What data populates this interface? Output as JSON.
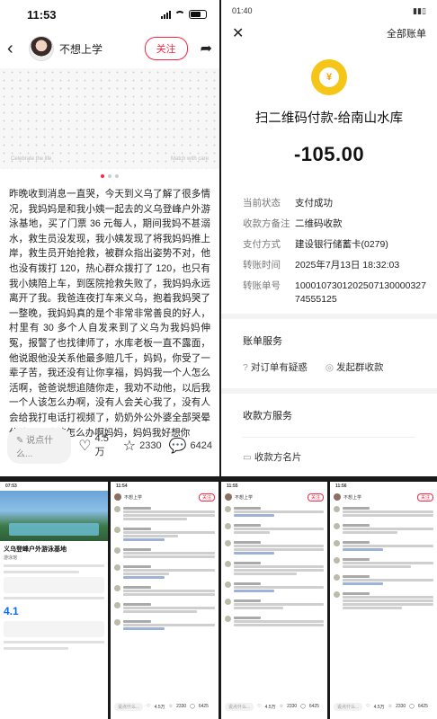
{
  "left_phone": {
    "status_time": "11:53",
    "username": "不想上学",
    "follow_label": "关注",
    "photo_caption_left": "Celebrate the life",
    "photo_caption_right": "Match with care",
    "post_text": "昨晚收到消息一直哭，今天到义乌了解了很多情况，我妈妈是和我小姨一起去的义乌登峰户外游泳基地，买了门票 36 元每人，期间我妈不甚溺水，救生员没发现，我小姨发现了将我妈妈推上岸，救生员开始抢救，被群众指出姿势不对，他也没有拨打 120，热心群众拨打了 120，也只有我小姨陪上车，到医院抢救失败了，我妈妈永远离开了我。我爸连夜打车来义乌，抱着我妈哭了一整晚，我妈妈真的是个非常非常善良的好人，村里有 30 多个人自发来到了义乌为我妈妈伸冤，报警了也找律师了，水库老板一直不露面，他说跟他没关系他最多赔几千，妈妈，你受了一辈子苦，我还没有让你享福，妈妈我一个人怎么活啊，爸爸说想追随你走，我劝不动他，以后我一个人该怎么办啊，没有人会关心我了，没有人会给我打电话打视频了，奶奶外公外婆全部哭晕住院了，我该怎么办啊妈妈，妈妈我好想你",
    "comment_placeholder": "说点什么...",
    "likes": "4.5万",
    "stars": "2330",
    "comments": "6424"
  },
  "right_phone": {
    "status_time": "01:40",
    "header_title": "全部账单",
    "payee": "扫二维码付款-给南山水库",
    "amount": "-105.00",
    "details": [
      {
        "k": "当前状态",
        "v": "支付成功"
      },
      {
        "k": "收款方备注",
        "v": "二维码收款"
      },
      {
        "k": "支付方式",
        "v": "建设银行储蓄卡(0279)"
      },
      {
        "k": "转账时间",
        "v": "2025年7月13日 18:32:03"
      },
      {
        "k": "转账单号",
        "v": "100010730120250713000032774555125"
      }
    ],
    "bill_service": "账单服务",
    "doubt_label": "对订单有疑惑",
    "group_pay_label": "发起群收款",
    "payee_service": "收款方服务",
    "payee_card": "收款方名片"
  },
  "bottom": {
    "m1": {
      "time": "07:53",
      "title": "义乌登峰户外游泳基地",
      "subtitle": "游泳馆",
      "score": "4.1"
    },
    "m2": {
      "time": "11:54",
      "username": "不想上学",
      "likes": "4.5万",
      "stars": "2330",
      "comments": "6425"
    },
    "m3": {
      "time": "11:55",
      "username": "不想上学",
      "likes": "4.5万",
      "stars": "2330",
      "comments": "6425"
    },
    "m4": {
      "time": "11:56",
      "username": "不想上学",
      "likes": "4.5万",
      "stars": "2330",
      "comments": "6425"
    },
    "follow_label": "关注",
    "comment_placeholder": "说点什么..."
  }
}
